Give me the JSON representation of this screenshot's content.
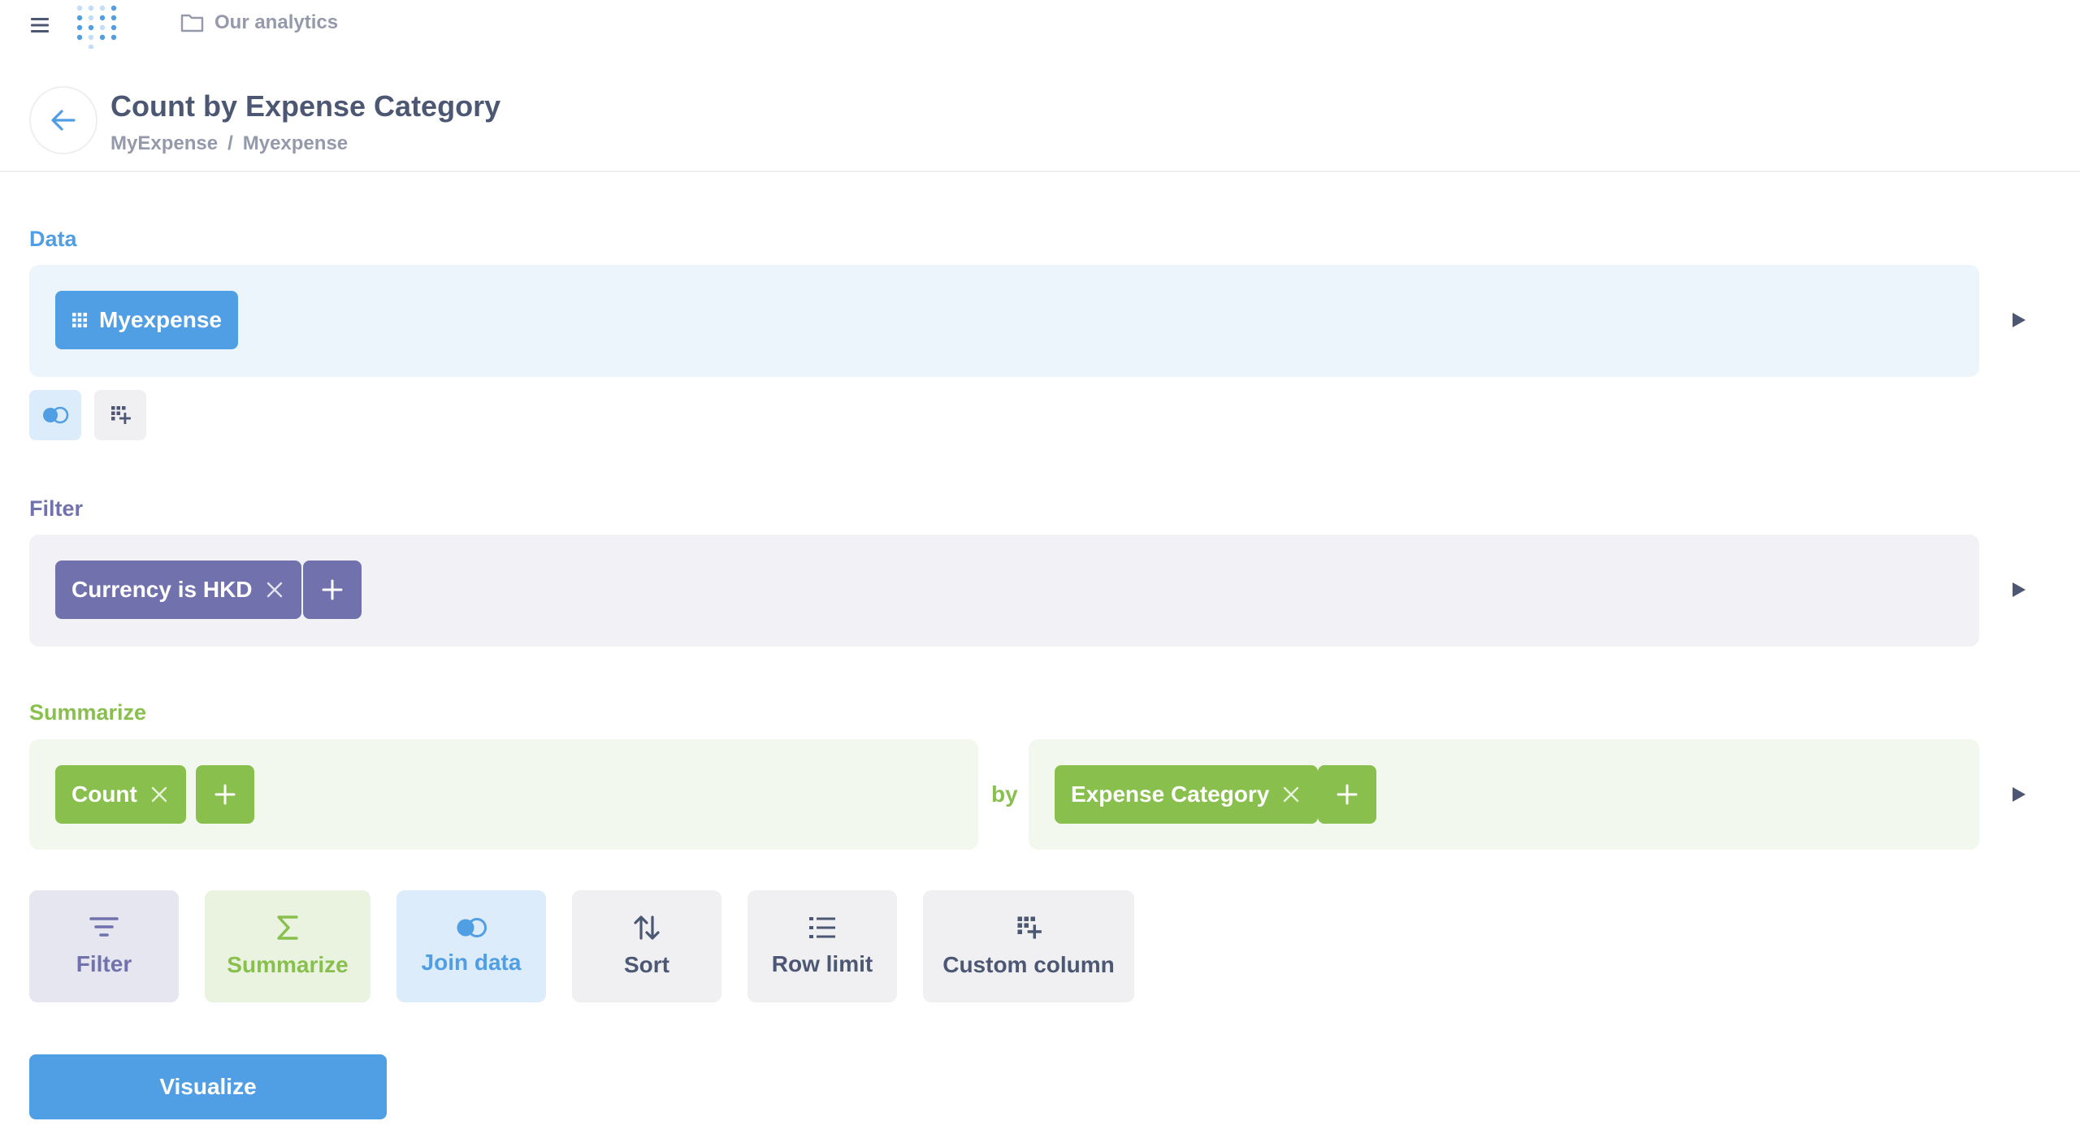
{
  "nav": {
    "menu_icon": "hamburger-menu-icon",
    "logo": "metabase-logo",
    "collection_label": "Our analytics",
    "collection_icon": "folder-icon"
  },
  "header": {
    "title": "Count by Expense Category",
    "breadcrumbs": [
      "MyExpense",
      "Myexpense"
    ],
    "breadcrumb_separator": "/"
  },
  "data_step": {
    "label": "Data",
    "table_name": "Myexpense",
    "table_icon": "table-grid-icon"
  },
  "filter_step": {
    "label": "Filter",
    "filters": [
      "Currency is HKD"
    ]
  },
  "summarize_step": {
    "label": "Summarize",
    "metrics": [
      "Count"
    ],
    "by_label": "by",
    "breakouts": [
      "Expense Category"
    ]
  },
  "actions": [
    {
      "label": "Filter",
      "icon": "filter-icon"
    },
    {
      "label": "Summarize",
      "icon": "sigma-icon"
    },
    {
      "label": "Join data",
      "icon": "join-icon"
    },
    {
      "label": "Sort",
      "icon": "sort-icon"
    },
    {
      "label": "Row limit",
      "icon": "list-icon"
    },
    {
      "label": "Custom column",
      "icon": "add-column-icon"
    }
  ],
  "visualize_label": "Visualize",
  "colors": {
    "brand": "#509ee3",
    "filter": "#7172ad",
    "summarize": "#88bf4d",
    "text_dark": "#4c5773",
    "text_light": "#949aab"
  }
}
